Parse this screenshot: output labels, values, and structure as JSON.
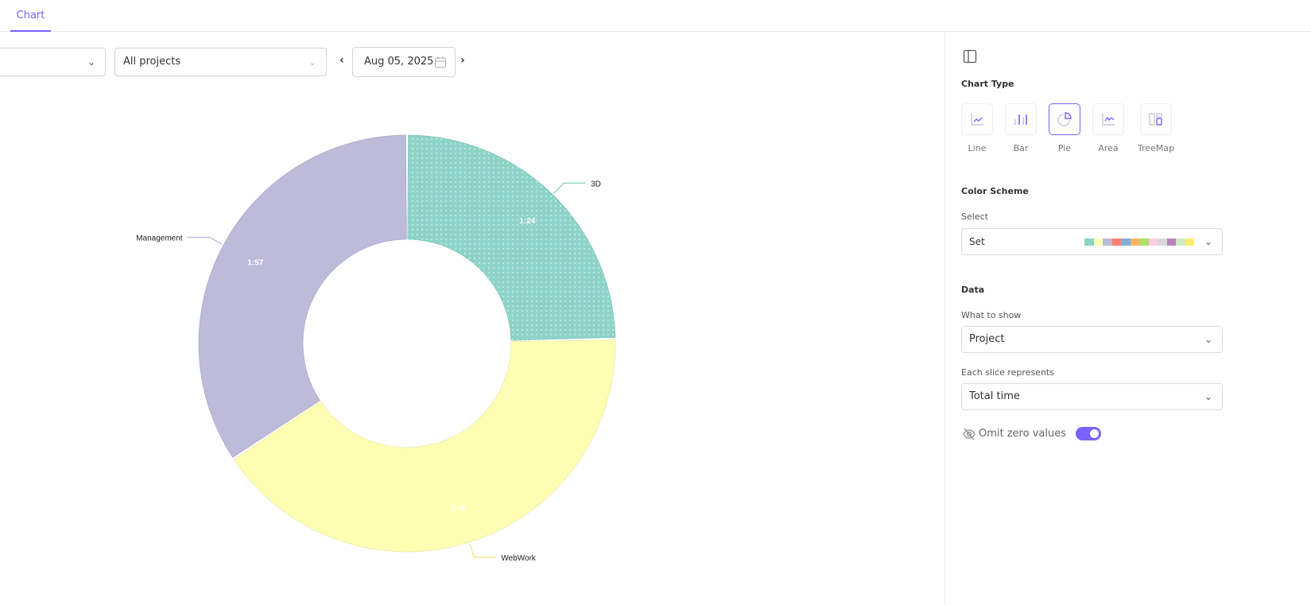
{
  "tabs": [
    {
      "label": "Chart",
      "active": true
    }
  ],
  "filters": {
    "first_select": "",
    "projects": "All projects",
    "date": "Aug 05, 2025"
  },
  "panel": {
    "chart_type_heading": "Chart Type",
    "chart_types": [
      {
        "label": "Line"
      },
      {
        "label": "Bar"
      },
      {
        "label": "Pie",
        "selected": true
      },
      {
        "label": "Area"
      },
      {
        "label": "TreeMap"
      }
    ],
    "color_scheme_heading": "Color Scheme",
    "select_label": "Select",
    "scheme": "Set",
    "scheme_colors": [
      "#8dd3c7",
      "#ffffb3",
      "#bebada",
      "#fb8072",
      "#80b1d3",
      "#fdb462",
      "#b3de69",
      "#fccde5",
      "#d9d9d9",
      "#bc80bd",
      "#ccebc5",
      "#ffed6f"
    ],
    "data_heading": "Data",
    "what_label": "What to show",
    "what_value": "Project",
    "slice_label": "Each slice represents",
    "slice_value": "Total time",
    "omit_label": "Omit zero values",
    "omit_on": true
  },
  "chart_data": {
    "type": "pie",
    "donut": true,
    "categories": [
      "3D",
      "WebWork",
      "Management"
    ],
    "values": [
      84,
      140,
      117
    ],
    "labels": [
      "1:24",
      "2:20",
      "1:57"
    ],
    "colors": [
      "#8dd3c7",
      "#ffffb3",
      "#bebada"
    ]
  }
}
